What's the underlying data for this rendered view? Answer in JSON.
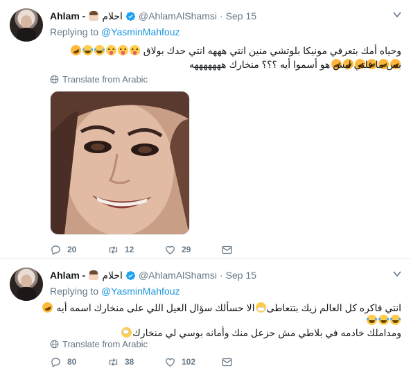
{
  "tweets": [
    {
      "display_name": "Ahlam -",
      "display_name_arabic": "احلام",
      "handle": "@AhlamAlShamsi",
      "date": "Sep 15",
      "replying_prefix": "Replying to",
      "replying_to": "@YasminMahfouz",
      "text_line_1": "وحياه أمك بتعرفي مونيكا بلوتشي منين انتي هههه انتي حدك بولاق",
      "text_line_2": "بس ما قلتي ليش هو أسموا أيه ؟؟؟ منخارك هههههههه",
      "translate_label": "Translate from Arabic",
      "reply_count": "20",
      "retweet_count": "12",
      "like_count": "29"
    },
    {
      "display_name": "Ahlam -",
      "display_name_arabic": "احلام",
      "handle": "@AhlamAlShamsi",
      "date": "Sep 15",
      "replying_prefix": "Replying to",
      "replying_to": "@YasminMahfouz",
      "text_line_1": "انتي فاكره كل العالم زيك بتتعاطى",
      "text_line_1b": "الا حسألك سؤال العيل اللي على منخارك اسمه أيه",
      "text_line_3": "ومداملك خادمه في بلاطي مش حزعل منك وأمانه بوسي لي منخارك",
      "translate_label": "Translate from Arabic",
      "reply_count": "80",
      "retweet_count": "38",
      "like_count": "102"
    }
  ],
  "colors": {
    "accent": "#1b95e0",
    "muted": "#657786",
    "verified": "#1da1f2",
    "divider": "#e6ecf0"
  },
  "icons": [
    "verified-icon",
    "caret-down-icon",
    "globe-icon",
    "reply-icon",
    "retweet-icon",
    "like-icon",
    "direct-message-icon"
  ]
}
